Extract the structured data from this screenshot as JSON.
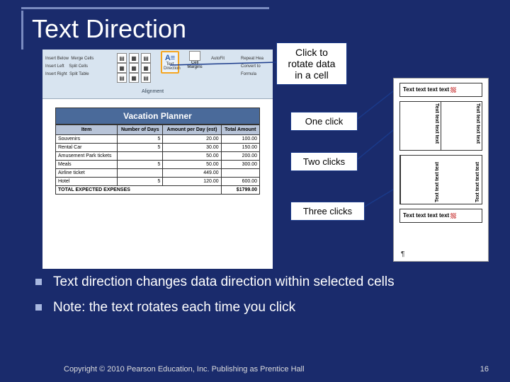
{
  "title": "Text Direction",
  "ribbon": {
    "left_items": [
      "Insert Below",
      "Merge Cells",
      "Insert Left",
      "Split Cells",
      "Insert Right",
      "Split Table"
    ],
    "text_dir_label": "Text Direction",
    "text_dir_glyph": "A≡",
    "cell_margins": "Cell Margins",
    "alignment": "Alignment",
    "autofit": "AutoFit",
    "right_items": [
      "Repeat Hea",
      "Convert to",
      "Formula"
    ]
  },
  "planner": {
    "title": "Vacation Planner",
    "cols": [
      "Item",
      "Number of Days",
      "Amount per Day (est)",
      "Total Amount"
    ],
    "rows": [
      [
        "Souvenirs",
        "5",
        "20.00",
        "100.00"
      ],
      [
        "Rental Car",
        "5",
        "30.00",
        "150.00"
      ],
      [
        "Amusement Park tickets",
        "",
        "50.00",
        "200.00"
      ],
      [
        "Meals",
        "5",
        "50.00",
        "300.00"
      ],
      [
        "Airline ticket",
        "",
        "449.00",
        ""
      ],
      [
        "Hotel",
        "5",
        "120.00",
        "600.00"
      ]
    ],
    "total_label": "TOTAL EXPECTED EXPENSES",
    "total_val": "$1799.00"
  },
  "callouts": {
    "c0": "Click to rotate data in a cell",
    "c1": "One click",
    "c2": "Two clicks",
    "c3": "Three clicks"
  },
  "sample_text": "Text text text text",
  "bul1": "Text direction changes data direction within selected cells",
  "bul2": "Note: the text rotates each time you click",
  "copyright": "Copyright © 2010 Pearson Education, Inc. Publishing as Prentice Hall",
  "page": "16"
}
